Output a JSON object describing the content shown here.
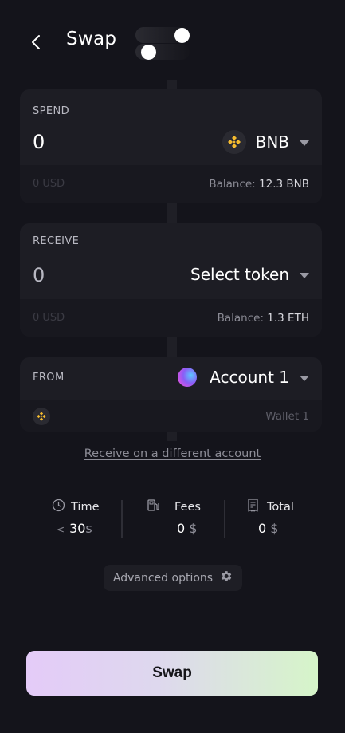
{
  "header": {
    "title": "Swap",
    "back_icon": "chevron-left-icon"
  },
  "spend": {
    "label": "SPEND",
    "amount": "0",
    "token": "BNB",
    "token_icon": "bnb-icon",
    "usd": "0 USD",
    "balance_label": "Balance:",
    "balance_value": "12.3 BNB"
  },
  "receive": {
    "label": "RECEIVE",
    "amount": "0",
    "token": "Select token",
    "usd": "0 USD",
    "balance_label": "Balance:",
    "balance_value": "1.3 ETH"
  },
  "from": {
    "label": "FROM",
    "account": "Account 1",
    "wallet": "Wallet 1",
    "wallet_icon": "bnb-icon"
  },
  "receive_link": "Receive on a different account",
  "stats": {
    "time": {
      "label": "Time",
      "prefix": "<",
      "value": "30",
      "unit": "s",
      "icon": "clock-icon"
    },
    "fees": {
      "label": "Fees",
      "value": "0",
      "unit": "$",
      "icon": "gas-pump-icon"
    },
    "total": {
      "label": "Total",
      "value": "0",
      "unit": "$",
      "icon": "receipt-icon"
    }
  },
  "advanced_options": {
    "label": "Advanced options",
    "icon": "gear-icon"
  },
  "swap_button": "Swap",
  "colors": {
    "background": "#14141b",
    "card": "#1d1d24",
    "bnb": "#f3ba2f",
    "button_gradient_start": "#e4cbf8",
    "button_gradient_end": "#d6f5c9"
  }
}
